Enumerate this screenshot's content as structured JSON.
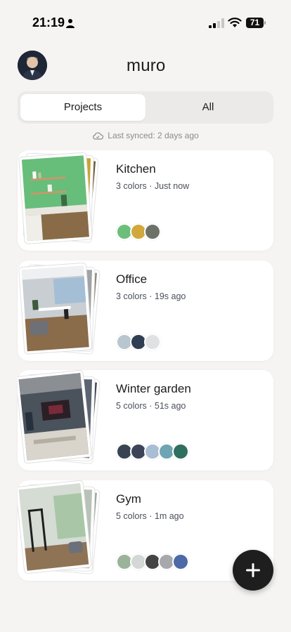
{
  "status_bar": {
    "time": "21:19",
    "battery": "71"
  },
  "header": {
    "title": "muro"
  },
  "tabs": [
    {
      "label": "Projects",
      "active": true
    },
    {
      "label": "All",
      "active": false
    }
  ],
  "sync_text": "Last synced: 2 days ago",
  "projects": [
    {
      "name": "Kitchen",
      "meta": "3 colors · Just now",
      "colors": [
        "#6cbf7b",
        "#d2a73b",
        "#6d7268"
      ]
    },
    {
      "name": "Office",
      "meta": "3 colors · 19s ago",
      "colors": [
        "#b8c6d0",
        "#2f3e52",
        "#dfe1e2"
      ]
    },
    {
      "name": "Winter garden",
      "meta": "5 colors · 51s ago",
      "colors": [
        "#394452",
        "#3d4359",
        "#a9bdd4",
        "#6fa4b3",
        "#2f6f60"
      ]
    },
    {
      "name": "Gym",
      "meta": "5 colors · 1m ago",
      "colors": [
        "#9bb39a",
        "#d3d8d6",
        "#444444",
        "#a7a8ac",
        "#4c6ba6"
      ]
    }
  ]
}
